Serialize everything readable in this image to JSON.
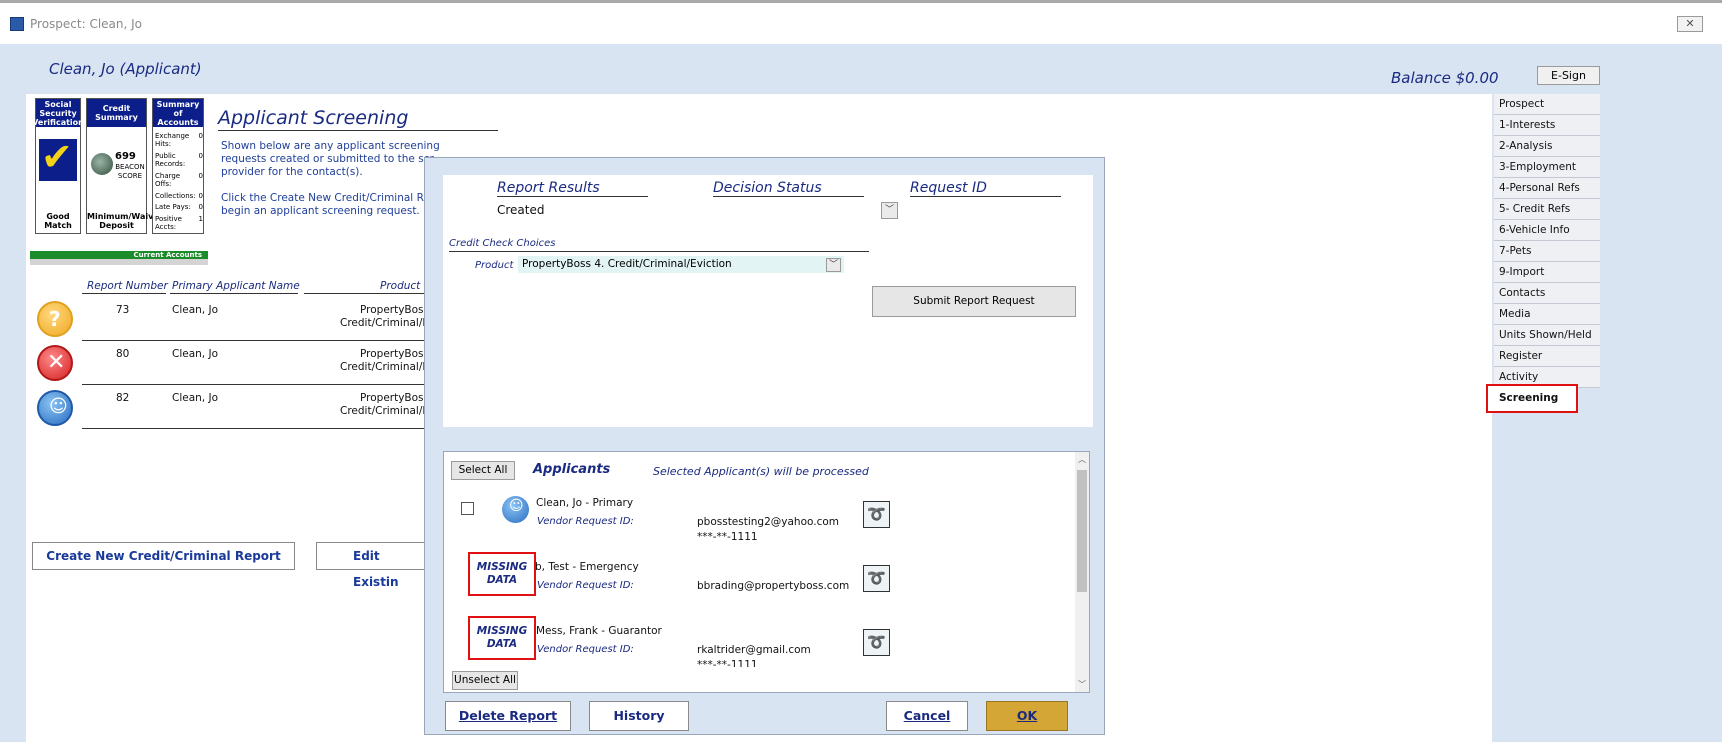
{
  "window": {
    "title": "Prospect: Clean, Jo",
    "close_icon": "close-icon"
  },
  "header": {
    "applicant": "Clean, Jo (Applicant)",
    "balance": "Balance $0.00",
    "esign_label": "E-Sign"
  },
  "tiles": {
    "ssv": {
      "title": "Social Security Verification",
      "result": "Good Match"
    },
    "credit": {
      "title": "Credit Summary",
      "score": "699",
      "score_label": "BEACON SCORE",
      "result": "Minimum/Waive Deposit"
    },
    "summary": {
      "title": "Summary of Accounts",
      "rows": [
        {
          "label": "Exchange Hits:",
          "value": "0"
        },
        {
          "label": "Public Records:",
          "value": "0"
        },
        {
          "label": "Charge Offs:",
          "value": "0"
        },
        {
          "label": "Collections:",
          "value": "0"
        },
        {
          "label": "Late Pays:",
          "value": "0"
        },
        {
          "label": "Positive Accts:",
          "value": "1"
        }
      ]
    },
    "current_accounts": "Current Accounts"
  },
  "screening": {
    "title": "Applicant Screening",
    "desc1": [
      "Shown below are any applicant screening",
      "requests created or submitted to the scr",
      "provider for the contact(s)."
    ],
    "desc2": [
      "Click the Create New Credit/Criminal Re",
      "begin an applicant screening request."
    ],
    "columns": {
      "report_number": "Report Number",
      "primary_name": "Primary Applicant Name",
      "product": "Product"
    },
    "rows": [
      {
        "number": "73",
        "name": "Clean, Jo",
        "product1": "PropertyBoss",
        "product2": "Credit/Criminal/E",
        "icon": "question-icon"
      },
      {
        "number": "80",
        "name": "Clean, Jo",
        "product1": "PropertyBoss",
        "product2": "Credit/Criminal/E",
        "icon": "error-x-icon"
      },
      {
        "number": "82",
        "name": "Clean, Jo",
        "product1": "PropertyBoss",
        "product2": "Credit/Criminal/E",
        "icon": "person-icon"
      }
    ],
    "create_btn": "Create New Credit/Criminal Report",
    "edit_btn": "Edit Existin"
  },
  "nav": {
    "items": [
      "Prospect",
      "1-Interests",
      "2-Analysis",
      "3-Employment",
      "4-Personal Refs",
      "5- Credit Refs",
      "6-Vehicle Info",
      "7-Pets",
      "9-Import",
      "Contacts",
      "Media",
      "Units Shown/Held",
      "Register",
      "Activity",
      "Screening"
    ],
    "active": "Screening"
  },
  "dialog": {
    "report_results_label": "Report Results",
    "report_results_value": "Created",
    "decision_status_label": "Decision Status",
    "request_id_label": "Request ID",
    "credit_check_label": "Credit Check Choices",
    "product_label": "Product",
    "product_value": "PropertyBoss 4. Credit/Criminal/Eviction",
    "submit_btn": "Submit Report Request",
    "select_all": "Select All",
    "unselect_all": "Unselect All",
    "applicants_title": "Applicants",
    "applicants_note": "Selected Applicant(s) will be processed",
    "vendor_label": "Vendor Request ID:",
    "missing_line1": "MISSING",
    "missing_line2": "DATA",
    "applicants": [
      {
        "name": "Clean, Jo  - Primary",
        "email": "pbosstesting2@yahoo.com",
        "ssn": "***-**-1111"
      },
      {
        "name": "b, Test  - Emergency",
        "email": "bbrading@propertyboss.com",
        "ssn": ""
      },
      {
        "name": "Mess, Frank  - Guarantor",
        "email": "rkaltrider@gmail.com",
        "ssn": "***-**-1111"
      }
    ],
    "delete_btn": "Delete Report",
    "history_btn": "History",
    "cancel_btn": "Cancel",
    "ok_btn": "OK"
  }
}
